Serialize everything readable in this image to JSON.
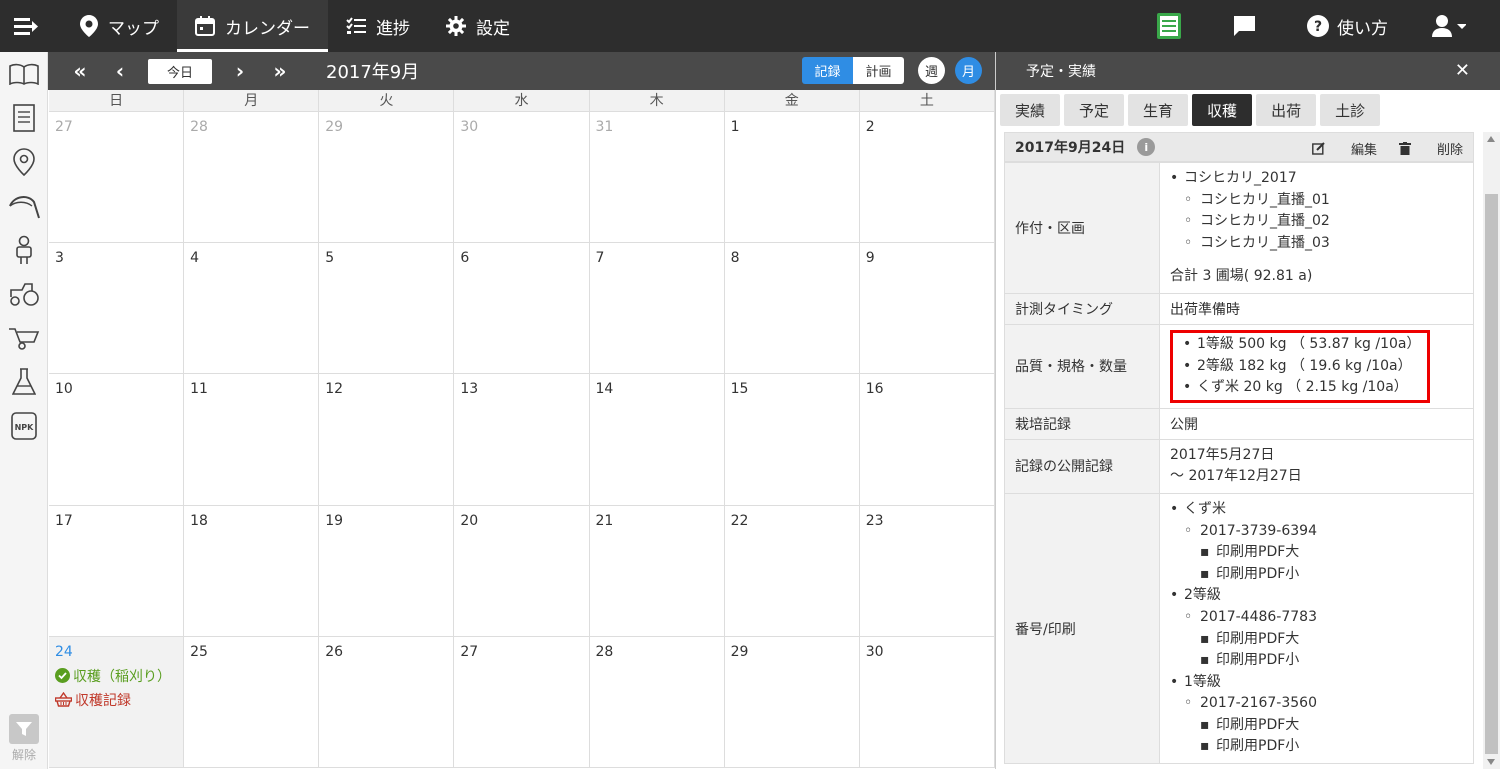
{
  "topnav": {
    "items": [
      {
        "label": "マップ",
        "icon": "map-pin-icon"
      },
      {
        "label": "カレンダー",
        "icon": "calendar-icon",
        "active": true
      },
      {
        "label": "進捗",
        "icon": "checklist-icon"
      },
      {
        "label": "設定",
        "icon": "gear-icon"
      }
    ],
    "help_label": "使い方",
    "accent": "#2f8de4"
  },
  "sidebar": {
    "icons": [
      "book-icon",
      "document-icon",
      "location-icon",
      "sickle-icon",
      "worker-icon",
      "tractor-icon",
      "wheelbarrow-icon",
      "flask-icon",
      "npk-fertilizer-icon"
    ],
    "npk_label": "NPK",
    "filter_label": "解除"
  },
  "calendar": {
    "today_label": "今日",
    "title": "2017年9月",
    "record_label": "記録",
    "plan_label": "計画",
    "week_label": "週",
    "month_label": "月",
    "dow": [
      "日",
      "月",
      "火",
      "水",
      "木",
      "金",
      "土"
    ],
    "weeks": [
      [
        {
          "d": "27",
          "o": true
        },
        {
          "d": "28",
          "o": true
        },
        {
          "d": "29",
          "o": true
        },
        {
          "d": "30",
          "o": true
        },
        {
          "d": "31",
          "o": true
        },
        {
          "d": "1"
        },
        {
          "d": "2"
        }
      ],
      [
        {
          "d": "3"
        },
        {
          "d": "4"
        },
        {
          "d": "5"
        },
        {
          "d": "6"
        },
        {
          "d": "7"
        },
        {
          "d": "8"
        },
        {
          "d": "9"
        }
      ],
      [
        {
          "d": "10"
        },
        {
          "d": "11"
        },
        {
          "d": "12"
        },
        {
          "d": "13"
        },
        {
          "d": "14"
        },
        {
          "d": "15"
        },
        {
          "d": "16"
        }
      ],
      [
        {
          "d": "17"
        },
        {
          "d": "18"
        },
        {
          "d": "19"
        },
        {
          "d": "20"
        },
        {
          "d": "21"
        },
        {
          "d": "22"
        },
        {
          "d": "23"
        }
      ],
      [
        {
          "d": "24",
          "today": true
        },
        {
          "d": "25"
        },
        {
          "d": "26"
        },
        {
          "d": "27"
        },
        {
          "d": "28"
        },
        {
          "d": "29"
        },
        {
          "d": "30"
        }
      ]
    ],
    "events": {
      "harvest_done": "収穫（稲刈り）",
      "harvest_record": "収穫記録"
    }
  },
  "panel": {
    "title": "予定・実績",
    "tabs": [
      "実績",
      "予定",
      "生育",
      "収穫",
      "出荷",
      "土診"
    ],
    "active_tab": 3,
    "date": "2017年9月24日",
    "edit_label": "編集",
    "delete_label": "削除",
    "rows": {
      "crop_label": "作付・区画",
      "crop_name": "コシヒカリ_2017",
      "plots": [
        "コシヒカリ_直播_01",
        "コシヒカリ_直播_02",
        "コシヒカリ_直播_03"
      ],
      "plot_total": "合計 3 圃場( 92.81 a)",
      "timing_label": "計測タイミング",
      "timing_value": "出荷準備時",
      "quality_label": "品質・規格・数量",
      "quality": [
        "1等級 500 kg （ 53.87 kg /10a）",
        "2等級 182 kg （ 19.6 kg /10a）",
        "くず米 20 kg （ 2.15 kg /10a）"
      ],
      "cultivation_label": "栽培記録",
      "cultivation_value": "公開",
      "public_label": "記録の公開記録",
      "public_from": "2017年5月27日",
      "public_to": "〜 2017年12月27日",
      "number_label": "番号/印刷",
      "numbers": [
        {
          "grade": "くず米",
          "code": "2017-3739-6394"
        },
        {
          "grade": "2等級",
          "code": "2017-4486-7783"
        },
        {
          "grade": "1等級",
          "code": "2017-2167-3560"
        }
      ],
      "pdf_large": "印刷用PDF大",
      "pdf_small": "印刷用PDF小"
    }
  }
}
